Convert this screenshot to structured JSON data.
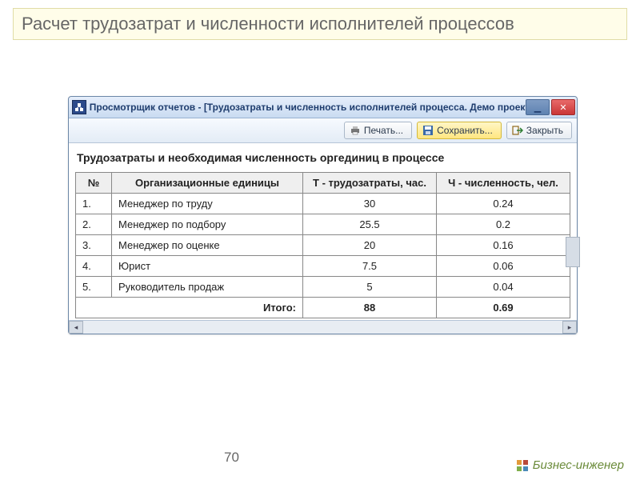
{
  "slide_title": "Расчет трудозатрат и численности исполнителей процессов",
  "window": {
    "title": "Просмотрщик отчетов -  [Трудозатраты и численность исполнителей процесса. Демо проект]"
  },
  "toolbar": {
    "print_label": "Печать...",
    "save_label": "Сохранить...",
    "close_label": "Закрыть"
  },
  "report": {
    "title": "Трудозатраты и необходимая численность оргединиц в процессе",
    "columns": {
      "num": "№",
      "org": "Организационные единицы",
      "t": "Т - трудозатраты, час.",
      "ch": "Ч - численность, чел."
    },
    "rows": [
      {
        "n": "1.",
        "org": "Менеджер по труду",
        "t": "30",
        "ch": "0.24"
      },
      {
        "n": "2.",
        "org": "Менеджер по подбору",
        "t": "25.5",
        "ch": "0.2"
      },
      {
        "n": "3.",
        "org": "Менеджер по оценке",
        "t": "20",
        "ch": "0.16"
      },
      {
        "n": "4.",
        "org": "Юрист",
        "t": "7.5",
        "ch": "0.06"
      },
      {
        "n": "5.",
        "org": "Руководитель продаж",
        "t": "5",
        "ch": "0.04"
      }
    ],
    "total_label": "Итого:",
    "total_t": "88",
    "total_ch": "0.69"
  },
  "page_number": "70",
  "brand": "Бизнес-инженер"
}
